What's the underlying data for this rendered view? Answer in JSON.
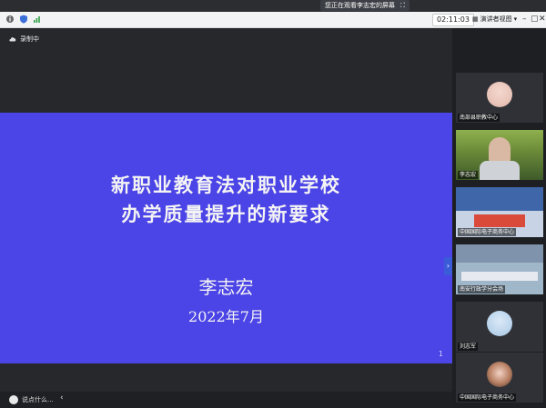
{
  "tooltip": {
    "text": "您正在观看李志宏的屏幕"
  },
  "topbar": {
    "timer": "02:11:03",
    "view_label": "演讲者视图"
  },
  "recording": {
    "label": "录制中"
  },
  "slide": {
    "title_line1": "新职业教育法对职业学校",
    "title_line2": "办学质量提升的新要求",
    "author": "李志宏",
    "date": "2022年7月",
    "page": "1"
  },
  "chat": {
    "label": "说点什么..."
  },
  "participants": [
    {
      "name": "南部县职教中心"
    },
    {
      "name": "李志宏"
    },
    {
      "name": "中国国际电子商务中心"
    },
    {
      "name": "南安行政学分会场"
    },
    {
      "name": "刘志军"
    },
    {
      "name": "中国国际电子商务中心"
    }
  ],
  "colors": {
    "slide_bg": "#4b44e6",
    "accent": "#3b5cd8"
  }
}
